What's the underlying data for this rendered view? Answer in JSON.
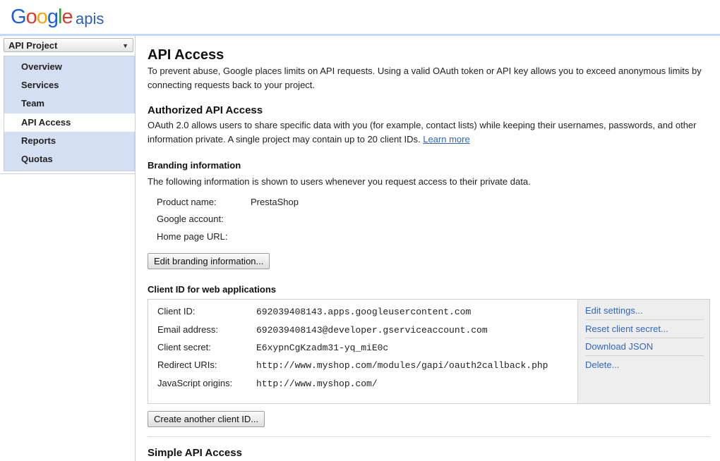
{
  "header": {
    "logo_letters": [
      "G",
      "o",
      "o",
      "g",
      "l",
      "e"
    ],
    "logo_suffix": "apis"
  },
  "sidebar": {
    "project_select": "API Project",
    "project_select_arrow": "▼",
    "items": [
      {
        "label": "Overview"
      },
      {
        "label": "Services"
      },
      {
        "label": "Team"
      },
      {
        "label": "API Access"
      },
      {
        "label": "Reports"
      },
      {
        "label": "Quotas"
      }
    ],
    "active_item": "API Access"
  },
  "main": {
    "title": "API Access",
    "intro": "To prevent abuse, Google places limits on API requests. Using a valid OAuth token or API key allows you to exceed anonymous limits by connecting requests back to your project.",
    "authorized": {
      "heading": "Authorized API Access",
      "text": "OAuth 2.0 allows users to share specific data with you (for example, contact lists) while keeping their usernames, passwords, and other information private. A single project may contain up to 20 client IDs.",
      "learn_more": "Learn more"
    },
    "branding": {
      "heading": "Branding information",
      "text": "The following information is shown to users whenever you request access to their private data.",
      "product_name_label": "Product name:",
      "product_name_value": "PrestaShop",
      "google_account_label": "Google account:",
      "google_account_value": "",
      "home_page_label": "Home page URL:",
      "home_page_value": "",
      "edit_button": "Edit branding information..."
    },
    "client": {
      "heading": "Client ID for web applications",
      "client_id_label": "Client ID:",
      "client_id_value": "692039408143.apps.googleusercontent.com",
      "email_label": "Email address:",
      "email_value": "692039408143@developer.gserviceaccount.com",
      "secret_label": "Client secret:",
      "secret_value": "E6xypnCgKzadm31-yq_miE0c",
      "redirect_label": "Redirect URIs:",
      "redirect_value": "http://www.myshop.com/modules/gapi/oauth2callback.php",
      "origins_label": "JavaScript origins:",
      "origins_value": "http://www.myshop.com/",
      "actions": {
        "edit_settings": "Edit settings...",
        "reset_secret": "Reset client secret...",
        "download_json": "Download JSON",
        "delete": "Delete..."
      },
      "create_button": "Create another client ID..."
    },
    "simple": {
      "heading": "Simple API Access"
    }
  }
}
